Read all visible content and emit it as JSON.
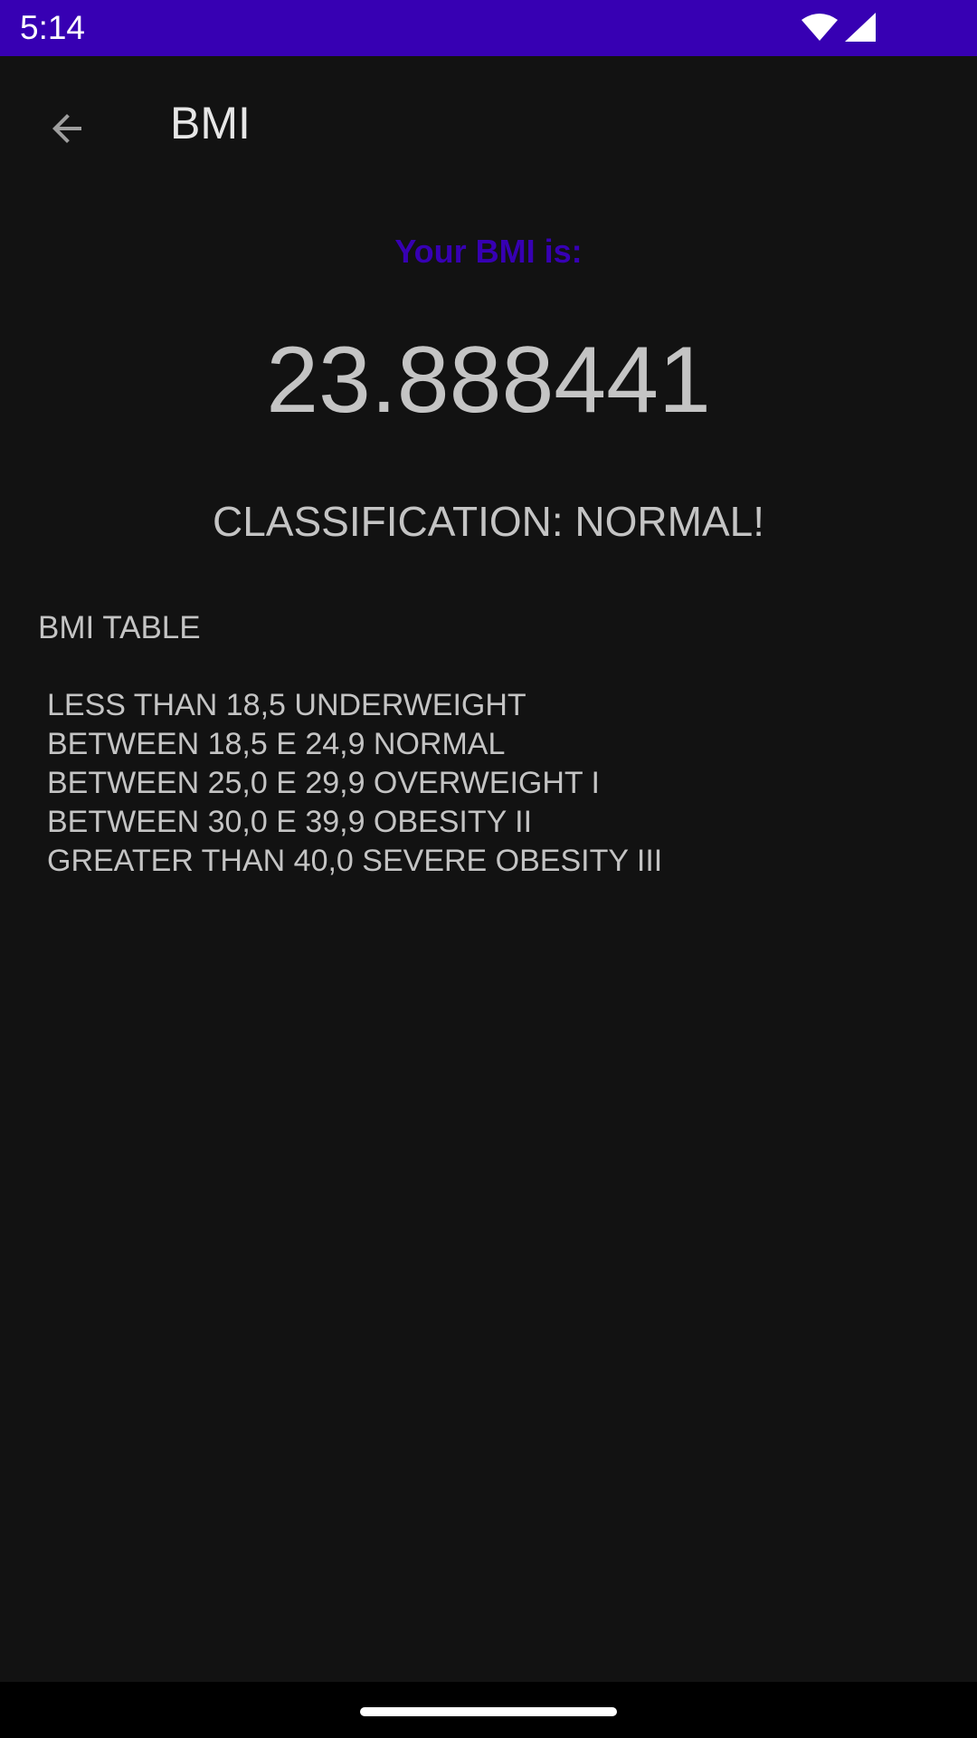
{
  "status_bar": {
    "time": "5:14",
    "background": "#3700b3"
  },
  "app_bar": {
    "title": "BMI",
    "back_icon": "arrow-back-icon"
  },
  "result": {
    "label": "Your BMI is:",
    "value": "23.888441",
    "classification": "CLASSIFICATION: NORMAL!",
    "accent_color": "#3700b3"
  },
  "bmi_table": {
    "heading": "BMI TABLE",
    "rows": [
      "LESS THAN 18,5 UNDERWEIGHT",
      "BETWEEN 18,5 E 24,9 NORMAL",
      "BETWEEN 25,0 E 29,9 OVERWEIGHT I",
      "BETWEEN 30,0 E 39,9 OBESITY II",
      "GREATER THAN 40,0 SEVERE OBESITY III"
    ]
  },
  "colors": {
    "background": "#121212",
    "text": "#c4c4c4"
  }
}
